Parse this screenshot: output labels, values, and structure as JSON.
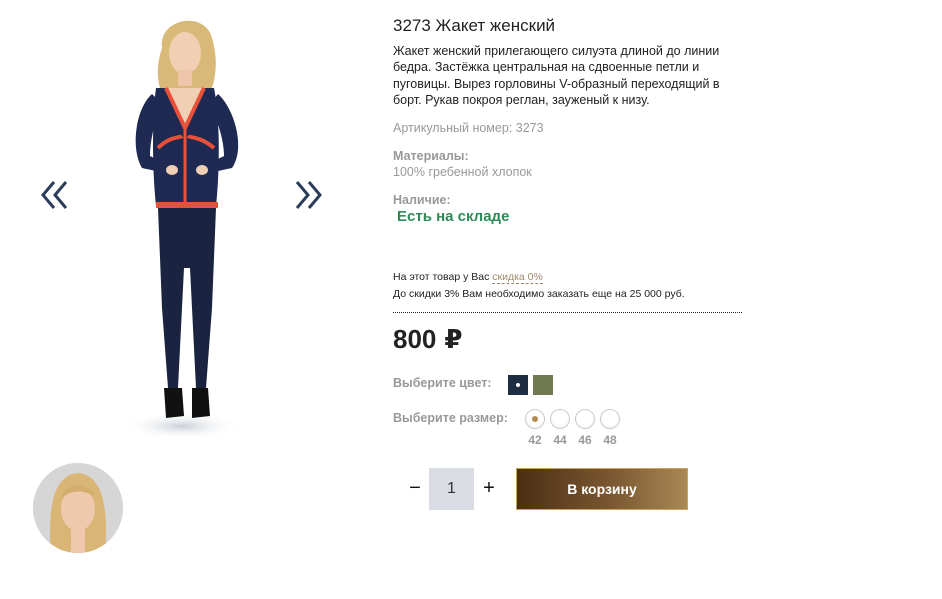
{
  "product": {
    "title": "3273 Жакет женский",
    "description": "Жакет женский прилегающего силуэта длиной до линии бедра. Застёжка центральная на сдвоенные петли и пуговицы. Вырез горловины V-образный переходящий в борт. Рукав покроя реглан, зауженый к низу.",
    "article": "Артикульный номер: 3273",
    "materials_label": "Материалы:",
    "materials_value": "100% гребенной хлопок",
    "availability_label": "Наличие:",
    "availability_value": "Есть на складе",
    "discount_text": "На этот товар у Вас",
    "discount_link": "скидка 0%",
    "discount_hint": "До скидки 3% Вам необходимо заказать еще на 25 000 руб.",
    "price": "800",
    "currency": "₽"
  },
  "options": {
    "color_label": "Выберите цвет:",
    "colors": [
      {
        "name": "navy",
        "hex": "#1d2e44",
        "selected": true
      },
      {
        "name": "olive",
        "hex": "#707a52",
        "selected": false
      }
    ],
    "size_label": "Выберите размер:",
    "sizes": [
      {
        "label": "42",
        "selected": true
      },
      {
        "label": "44",
        "selected": false
      },
      {
        "label": "46",
        "selected": false
      },
      {
        "label": "48",
        "selected": false
      }
    ]
  },
  "cart": {
    "minus": "−",
    "quantity": "1",
    "plus": "+",
    "button_label": "В корзину"
  },
  "gallery": {
    "prev_icon": "chevron-double-left-icon",
    "next_icon": "chevron-double-right-icon"
  }
}
